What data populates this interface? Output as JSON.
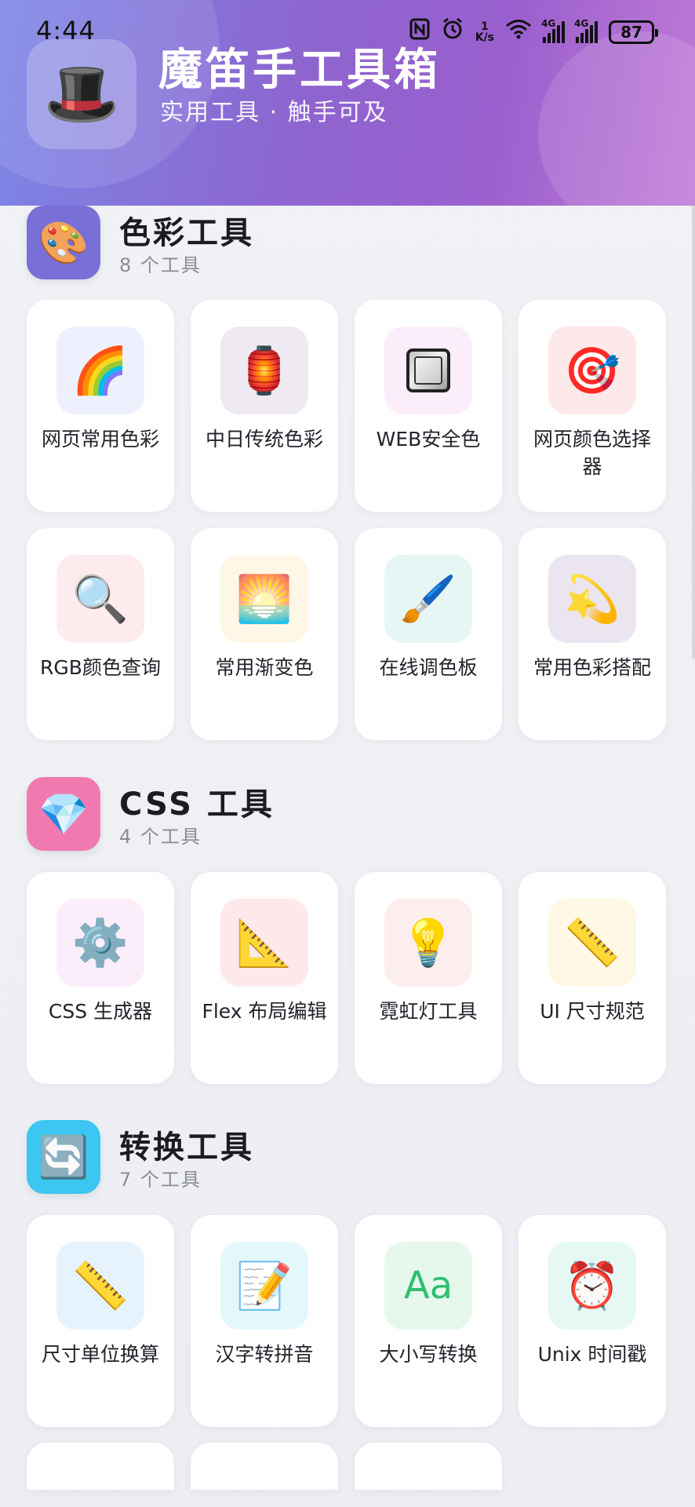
{
  "status_bar": {
    "time": "4:44",
    "nfc_icon": "nfc-icon",
    "alarm_icon": "alarm-icon",
    "net_speed_value": "1",
    "net_speed_unit": "K/s",
    "wifi_icon": "wifi-icon",
    "signal1_label": "4G",
    "signal2_label": "4G",
    "battery": "87"
  },
  "header": {
    "logo_icon": "🎩",
    "title": "魔笛手工具箱",
    "subtitle": "实用工具 · 触手可及",
    "gradient_colors": [
      "#7c86e6",
      "#8e64cf",
      "#9a5fce",
      "#c07ad6"
    ]
  },
  "sections": [
    {
      "title": "色彩工具",
      "count": "8 个工具",
      "icon": "🎨",
      "icon_bg": "#7a6fd6",
      "tools": [
        {
          "label": "网页常用色彩",
          "icon": "🌈",
          "tile_bg": "#eef0fd"
        },
        {
          "label": "中日传统色彩",
          "icon": "🏮",
          "tile_bg": "#efeaf1"
        },
        {
          "label": "WEB安全色",
          "icon": "square-frame-icon",
          "tile_bg": "#fbeefa"
        },
        {
          "label": "网页颜色选择器",
          "icon": "🎯",
          "tile_bg": "#fde8ea"
        },
        {
          "label": "RGB颜色查询",
          "icon": "🔍",
          "tile_bg": "#fdebee"
        },
        {
          "label": "常用渐变色",
          "icon": "🌅",
          "tile_bg": "#fef7e6"
        },
        {
          "label": "在线调色板",
          "icon": "🖌️",
          "tile_bg": "#e6f6f4"
        },
        {
          "label": "常用色彩搭配",
          "icon": "💫",
          "tile_bg": "#ebe5f0"
        }
      ]
    },
    {
      "title": "CSS 工具",
      "count": "4 个工具",
      "icon": "💎",
      "icon_bg": "#f07ab0",
      "tools": [
        {
          "label": "CSS 生成器",
          "icon": "⚙️",
          "tile_bg": "#fbeefa"
        },
        {
          "label": "Flex 布局编辑",
          "icon": "📐",
          "tile_bg": "#fde8ea"
        },
        {
          "label": "霓虹灯工具",
          "icon": "💡",
          "tile_bg": "#fdeeee"
        },
        {
          "label": "UI 尺寸规范",
          "icon": "📏",
          "tile_bg": "#fef8e4"
        }
      ]
    },
    {
      "title": "转换工具",
      "count": "7 个工具",
      "icon": "🔄",
      "icon_bg": "#3cc6f2",
      "tools": [
        {
          "label": "尺寸单位换算",
          "icon": "📏",
          "tile_bg": "#e6f3fd"
        },
        {
          "label": "汉字转拼音",
          "icon": "📝",
          "tile_bg": "#e3f8fb"
        },
        {
          "label": "大小写转换",
          "icon": "Aa",
          "tile_bg": "#e6f8ec"
        },
        {
          "label": "Unix 时间戳",
          "icon": "⏰",
          "tile_bg": "#e6f8f4"
        }
      ]
    }
  ]
}
